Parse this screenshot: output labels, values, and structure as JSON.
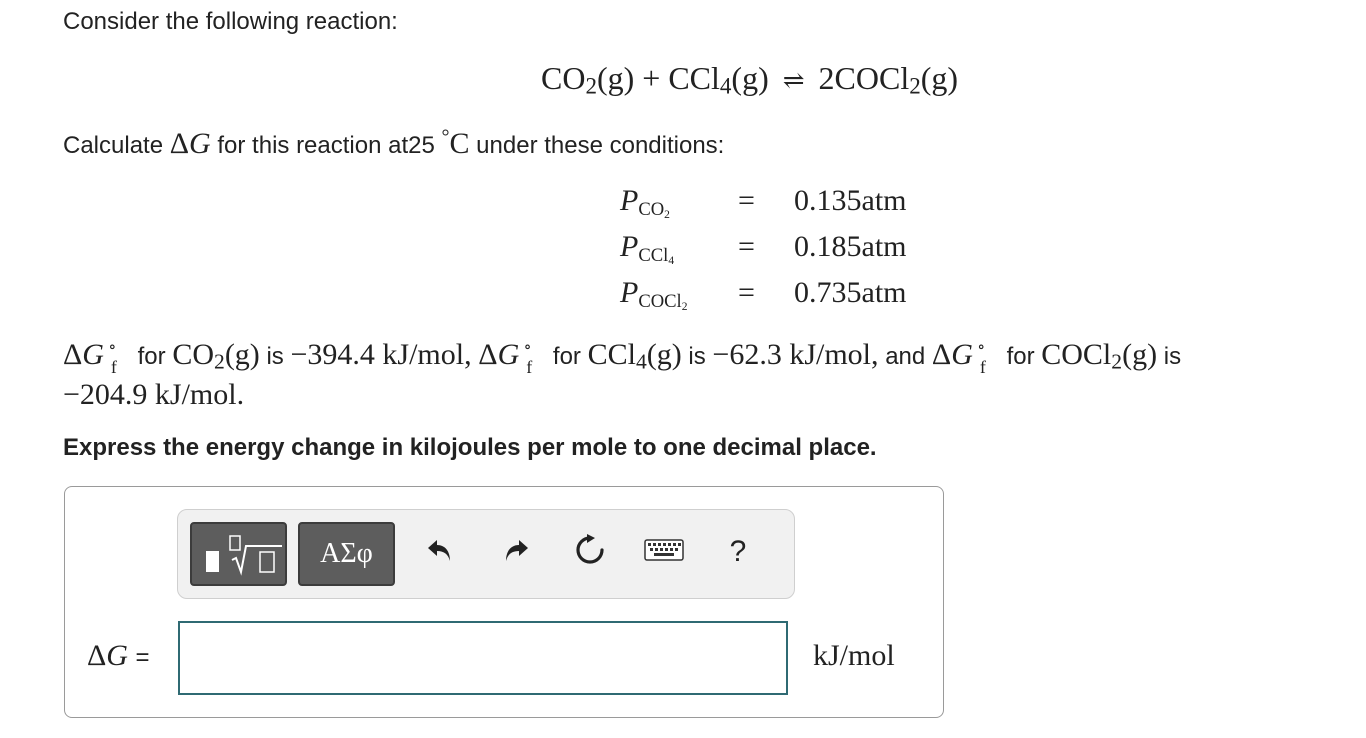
{
  "question": {
    "intro": "Consider the following reaction:",
    "equation": {
      "reactant1": "CO",
      "reactant1_sub": "2",
      "reactant1_state": "(g)",
      "plus": "+",
      "reactant2": "CCl",
      "reactant2_sub": "4",
      "reactant2_state": "(g)",
      "arrow": "⇌",
      "product": "2COCl",
      "product_sub": "2",
      "product_state": "(g)"
    },
    "prompt_pre": "Calculate ",
    "prompt_delta": "Δ",
    "prompt_g": "G",
    "prompt_mid": " for this reaction at25 ",
    "prompt_degree": "°",
    "prompt_c": "C",
    "prompt_post": " under these conditions:",
    "pressures": [
      {
        "symbol": "P",
        "sub_main": "CO",
        "sub_sub": "2",
        "equals": "=",
        "value": "0.135atm"
      },
      {
        "symbol": "P",
        "sub_main": "CCl",
        "sub_sub": "4",
        "equals": "=",
        "value": "0.185atm"
      },
      {
        "symbol": "P",
        "sub_main": "COCl",
        "sub_sub": "2",
        "equals": "=",
        "value": "0.735atm"
      }
    ],
    "gibbs": {
      "delta": "Δ",
      "g": "G",
      "circ": "∘",
      "f": "f",
      "for_word": "for",
      "is_word": "is",
      "comma": ",",
      "and_word": "and",
      "co2_formula": "CO",
      "co2_sub": "2",
      "co2_state": "(g)",
      "co2_value": "−394.4 kJ/mol",
      "ccl4_formula": "CCl",
      "ccl4_sub": "4",
      "ccl4_state": "(g)",
      "ccl4_value": "−62.3 kJ/mol",
      "cocl2_formula": "COCl",
      "cocl2_sub": "2",
      "cocl2_state": "(g)",
      "cocl2_value": "−204.9 kJ/mol."
    },
    "instruction": "Express the energy change in kilojoules per mole to one decimal place."
  },
  "answer": {
    "toolbar": {
      "template_icon": "template-sqrt-icon",
      "symbols_label": "ΑΣφ",
      "undo_icon": "undo-icon",
      "redo_icon": "redo-icon",
      "reset_icon": "reset-icon",
      "keyboard_icon": "keyboard-icon",
      "help_label": "?"
    },
    "label_delta": "Δ",
    "label_g": "G",
    "label_equals": "=",
    "input_value": "",
    "unit": "kJ/mol"
  },
  "colors": {
    "text": "#222222",
    "button_dark": "#5d5d5d",
    "toolbar_bg": "#f1f1f1",
    "input_border": "#2f6a73",
    "panel_border": "#9a9a9a"
  }
}
